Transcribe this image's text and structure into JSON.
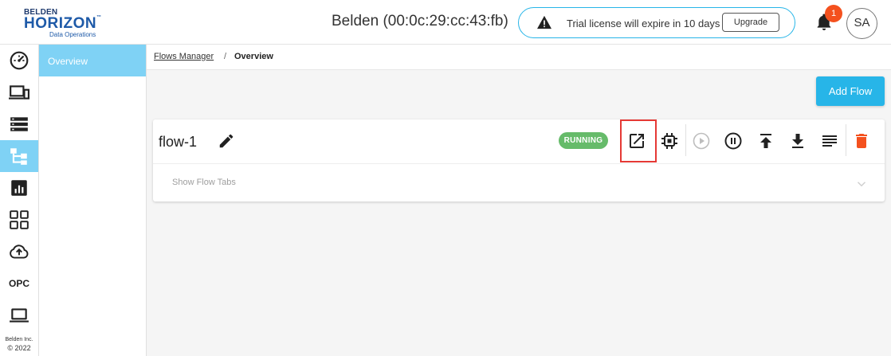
{
  "brand": {
    "line1": "BELDEN",
    "line2": "HORIZON",
    "tm": "™",
    "line3": "Data Operations"
  },
  "header": {
    "device_title": "Belden (00:0c:29:cc:43:fb)",
    "license_text": "Trial license will expire in 10 days",
    "upgrade_label": "Upgrade",
    "notification_count": "1",
    "avatar_initials": "SA"
  },
  "rail": {
    "items": [
      {
        "icon": "dashboard-gauge-icon"
      },
      {
        "icon": "devices-icon"
      },
      {
        "icon": "storage-list-icon"
      },
      {
        "icon": "flows-tree-icon",
        "active": true
      },
      {
        "icon": "analytics-chart-icon"
      },
      {
        "icon": "apps-grid-icon"
      },
      {
        "icon": "cloud-upload-icon"
      },
      {
        "icon": "opc-icon",
        "label": "OPC"
      },
      {
        "icon": "laptop-icon"
      }
    ],
    "copyright_line1": "Belden Inc.",
    "copyright_line2": "© 2022"
  },
  "subnav": {
    "items": [
      {
        "label": "Overview",
        "active": true
      }
    ]
  },
  "breadcrumb": {
    "parent": "Flows Manager",
    "separator": "/",
    "current": "Overview"
  },
  "add_flow_label": "Add Flow",
  "flow": {
    "name": "flow-1",
    "status": "RUNNING",
    "show_tabs_label": "Show Flow Tabs",
    "actions": [
      "open-external-icon",
      "chip-icon",
      "play-icon",
      "pause-icon",
      "upload-icon",
      "download-icon",
      "logs-icon",
      "delete-icon"
    ]
  },
  "colors": {
    "accent": "#27b5e8",
    "active_nav": "#7fd2f5",
    "running": "#66bb6a",
    "danger": "#f4511e",
    "highlight": "#e53935"
  }
}
